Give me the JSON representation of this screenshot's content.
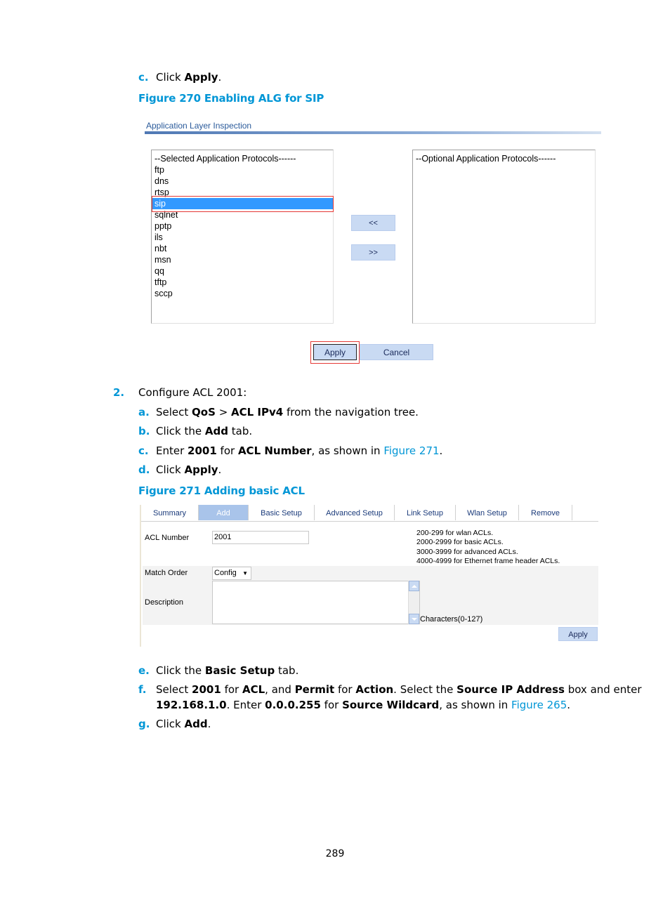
{
  "steps_top": [
    {
      "marker": "c.",
      "text_parts": [
        {
          "t": "Click ",
          "b": false
        },
        {
          "t": "Apply",
          "b": true
        },
        {
          "t": ".",
          "b": false
        }
      ]
    }
  ],
  "figure270": {
    "caption": "Figure 270 Enabling ALG for SIP",
    "section_title": "Application Layer Inspection",
    "selected_list": {
      "header": "--Selected Application Protocols------",
      "items": [
        "ftp",
        "dns",
        "rtsp",
        "sip",
        "sqlnet",
        "pptp",
        "ils",
        "nbt",
        "msn",
        "qq",
        "tftp",
        "sccp"
      ],
      "selected": "sip"
    },
    "optional_list": {
      "header": "--Optional Application Protocols------",
      "items": []
    },
    "move_left_label": "<<",
    "move_right_label": ">>",
    "apply_label": "Apply",
    "cancel_label": "Cancel"
  },
  "step2": {
    "marker": "2.",
    "text": "Configure ACL 2001:",
    "substeps": {
      "a": {
        "marker": "a.",
        "pre": "Select ",
        "b1": "QoS",
        "mid": " > ",
        "b2": "ACL IPv4",
        "post": " from the navigation tree."
      },
      "b": {
        "marker": "b.",
        "pre": "Click the ",
        "b1": "Add",
        "post": " tab."
      },
      "c": {
        "marker": "c.",
        "pre": "Enter ",
        "b1": "2001",
        "mid": " for ",
        "b2": "ACL Number",
        "mid2": ", as shown in ",
        "link": "Figure 271",
        "post": "."
      },
      "d": {
        "marker": "d.",
        "pre": "Click ",
        "b1": "Apply",
        "post": "."
      }
    }
  },
  "figure271": {
    "caption": "Figure 271 Adding basic ACL",
    "tabs": [
      "Summary",
      "Add",
      "Basic Setup",
      "Advanced Setup",
      "Link Setup",
      "Wlan Setup",
      "Remove"
    ],
    "active_tab": "Add",
    "acl_number_label": "ACL Number",
    "acl_number_value": "2001",
    "acl_ranges": [
      "200-299 for wlan ACLs.",
      "2000-2999 for basic ACLs.",
      "3000-3999 for advanced ACLs.",
      "4000-4999 for Ethernet frame header ACLs."
    ],
    "match_order_label": "Match Order",
    "match_order_value": "Config",
    "description_label": "Description",
    "description_value": "",
    "description_hint": "Characters(0-127)",
    "apply_label": "Apply"
  },
  "steps_bottom": {
    "e": {
      "marker": "e.",
      "pre": "Click the ",
      "b1": "Basic Setup",
      "post": " tab."
    },
    "f": {
      "marker": "f.",
      "line1": [
        {
          "t": "Select ",
          "b": false
        },
        {
          "t": "2001",
          "b": true
        },
        {
          "t": " for ",
          "b": false
        },
        {
          "t": "ACL",
          "b": true
        },
        {
          "t": ", and ",
          "b": false
        },
        {
          "t": "Permit",
          "b": true
        },
        {
          "t": " for ",
          "b": false
        },
        {
          "t": "Action",
          "b": true
        },
        {
          "t": ". Select the ",
          "b": false
        },
        {
          "t": "Source IP Address",
          "b": true
        },
        {
          "t": " box and enter",
          "b": false
        }
      ],
      "line2": [
        {
          "t": "192.168.1.0",
          "b": true
        },
        {
          "t": ". Enter ",
          "b": false
        },
        {
          "t": "0.0.0.255",
          "b": true
        },
        {
          "t": " for ",
          "b": false
        },
        {
          "t": "Source Wildcard",
          "b": true
        },
        {
          "t": ", as shown in ",
          "b": false
        }
      ],
      "link": "Figure 265",
      "post": "."
    },
    "g": {
      "marker": "g.",
      "pre": "Click ",
      "b1": "Add",
      "post": "."
    }
  },
  "page_number": "289"
}
